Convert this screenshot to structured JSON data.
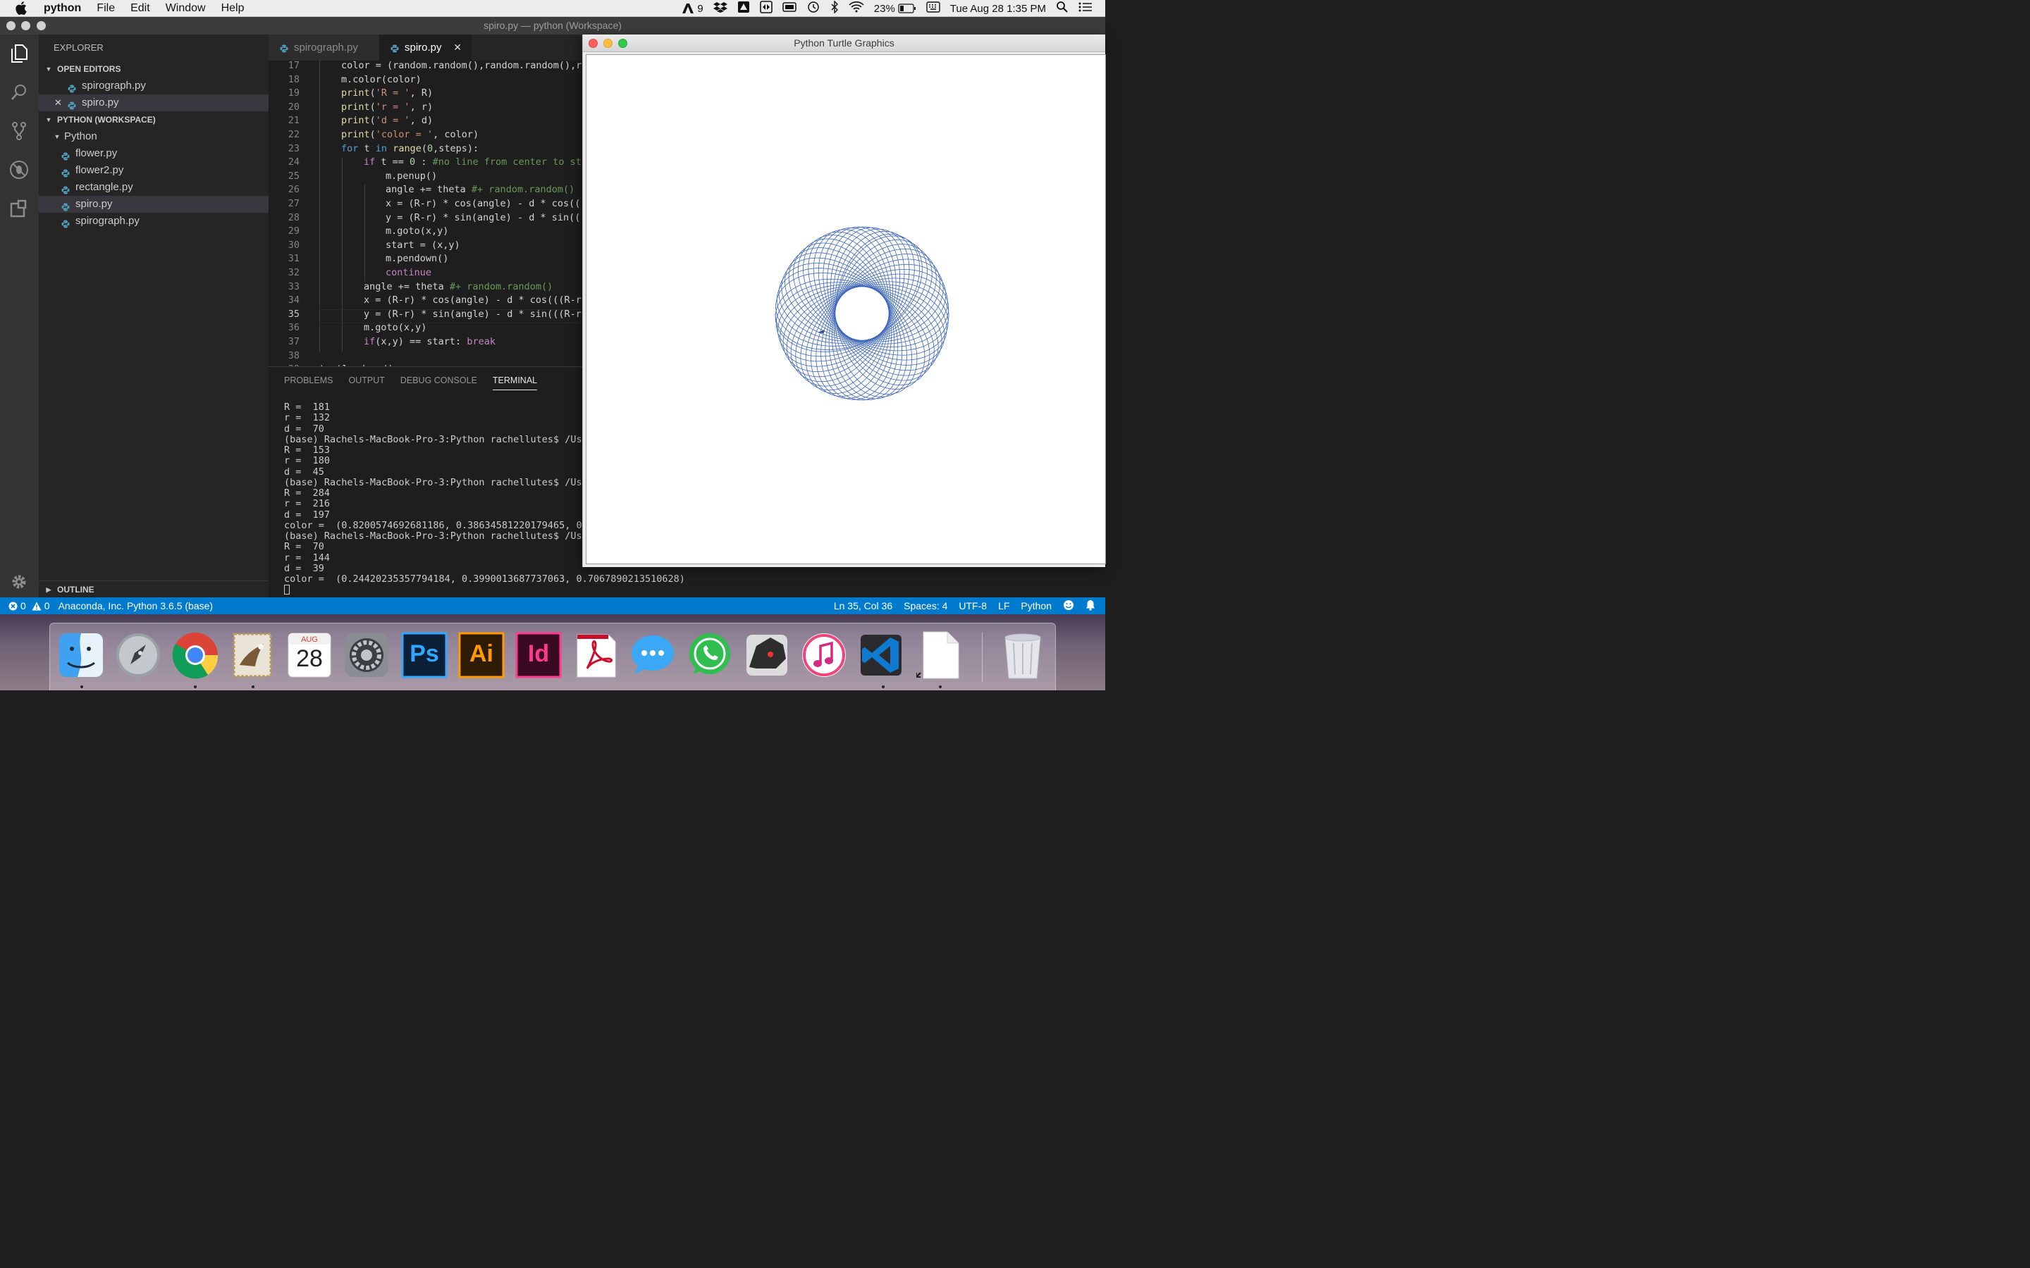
{
  "menubar": {
    "app_name": "python",
    "items": [
      "File",
      "Edit",
      "Window",
      "Help"
    ],
    "status_items": {
      "adobe_count": "9",
      "battery": "23%",
      "datetime": "Tue Aug 28  1:35 PM"
    }
  },
  "window": {
    "title": "spiro.py — python (Workspace)"
  },
  "explorer": {
    "title": "EXPLORER",
    "open_editors_label": "OPEN EDITORS",
    "open_editors": [
      "spirograph.py",
      "spiro.py"
    ],
    "workspace_label": "PYTHON (WORKSPACE)",
    "folder": "Python",
    "files": [
      "flower.py",
      "flower2.py",
      "rectangle.py",
      "spiro.py",
      "spirograph.py"
    ],
    "outline_label": "OUTLINE"
  },
  "tabs": [
    {
      "label": "spirograph.py"
    },
    {
      "label": "spiro.py"
    }
  ],
  "tab_close": "✕",
  "editor": {
    "current_line": "35"
  },
  "panel": {
    "tabs": [
      "PROBLEMS",
      "OUTPUT",
      "DEBUG CONSOLE",
      "TERMINAL"
    ],
    "terminal_lines": [
      "R =  181",
      "r =  132",
      "d =  70",
      "(base) Rachels-MacBook-Pro-3:Python rachellutes$ /Users/",
      "R =  153",
      "r =  180",
      "d =  45",
      "(base) Rachels-MacBook-Pro-3:Python rachellutes$ /Users/",
      "R =  284",
      "r =  216",
      "d =  197",
      "color =  (0.8200574692681186, 0.38634581220179465, 0.520",
      "(base) Rachels-MacBook-Pro-3:Python rachellutes$ /Users/",
      "R =  70",
      "r =  144",
      "d =  39",
      "color =  (0.24420235357794184, 0.3990013687737063, 0.7067890213510628)"
    ]
  },
  "statusbar": {
    "errors": "0",
    "warnings": "0",
    "interpreter": "Anaconda, Inc. Python 3.6.5 (base)",
    "position": "Ln 35, Col 36",
    "spaces": "Spaces: 4",
    "encoding": "UTF-8",
    "eol": "LF",
    "language": "Python"
  },
  "turtle": {
    "title": "Python Turtle Graphics",
    "spiro": {
      "R": 70,
      "r": 144,
      "d": 39,
      "color": "#3b65bb"
    }
  },
  "dock": {
    "calendar_month": "AUG",
    "calendar_day": "28",
    "ps": "Ps",
    "ai": "Ai",
    "id": "Id"
  }
}
